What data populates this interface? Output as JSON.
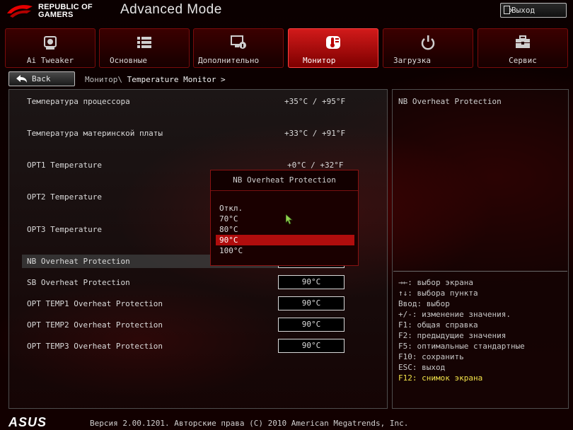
{
  "header": {
    "brand_line1": "REPUBLIC OF",
    "brand_line2": "GAMERS",
    "mode": "Advanced Mode",
    "exit_label": "Выход"
  },
  "tabs": [
    {
      "label": "Ai Tweaker",
      "icon": "cpu-fan-icon"
    },
    {
      "label": "Основные",
      "icon": "list-icon"
    },
    {
      "label": "Дополнительно",
      "icon": "monitor-info-icon"
    },
    {
      "label": "Монитор",
      "icon": "thermometer-icon",
      "active": true
    },
    {
      "label": "Загрузка",
      "icon": "power-icon"
    },
    {
      "label": "Сервис",
      "icon": "toolbox-icon"
    }
  ],
  "nav": {
    "back_label": "Back",
    "breadcrumb_parent": "Монитор\\",
    "breadcrumb_current": "Temperature Monitor >"
  },
  "readings": [
    {
      "label": "Температура процессора",
      "value": "+35°C / +95°F"
    },
    {
      "label": "Температура материнской платы",
      "value": "+33°C / +91°F"
    },
    {
      "label": "OPT1 Temperature",
      "value": "+0°C / +32°F"
    },
    {
      "label": "OPT2 Temperature",
      "value": ""
    },
    {
      "label": "OPT3 Temperature",
      "value": ""
    }
  ],
  "protections": [
    {
      "label": "NB Overheat Protection",
      "value": ""
    },
    {
      "label": "SB Overheat Protection",
      "value": "90°C"
    },
    {
      "label": "OPT TEMP1 Overheat Protection",
      "value": "90°C"
    },
    {
      "label": "OPT TEMP2 Overheat Protection",
      "value": "90°C"
    },
    {
      "label": "OPT TEMP3 Overheat Protection",
      "value": "90°C"
    }
  ],
  "popup": {
    "title": "NB Overheat Protection",
    "options": [
      "Откл.",
      "70°C",
      "80°C",
      "90°C",
      "100°C"
    ],
    "selected_index": 3
  },
  "help": {
    "title": "NB Overheat Protection",
    "lines": [
      "→←: выбор экрана",
      "↑↓: выбора пункта",
      "Ввод: выбор",
      "+/-: изменение значения.",
      "F1: общая справка",
      "F2: предыдущие значения",
      "F5: оптимальные стандартные",
      "F10: сохранить",
      "ESC: выход",
      "F12: снимок экрана"
    ]
  },
  "footer": {
    "logo": "ASUS",
    "text": "Версия 2.00.1201. Авторские права (C) 2010 American Megatrends, Inc."
  },
  "colors": {
    "accent": "#b00d0d",
    "hotkey": "#f2e24a"
  }
}
